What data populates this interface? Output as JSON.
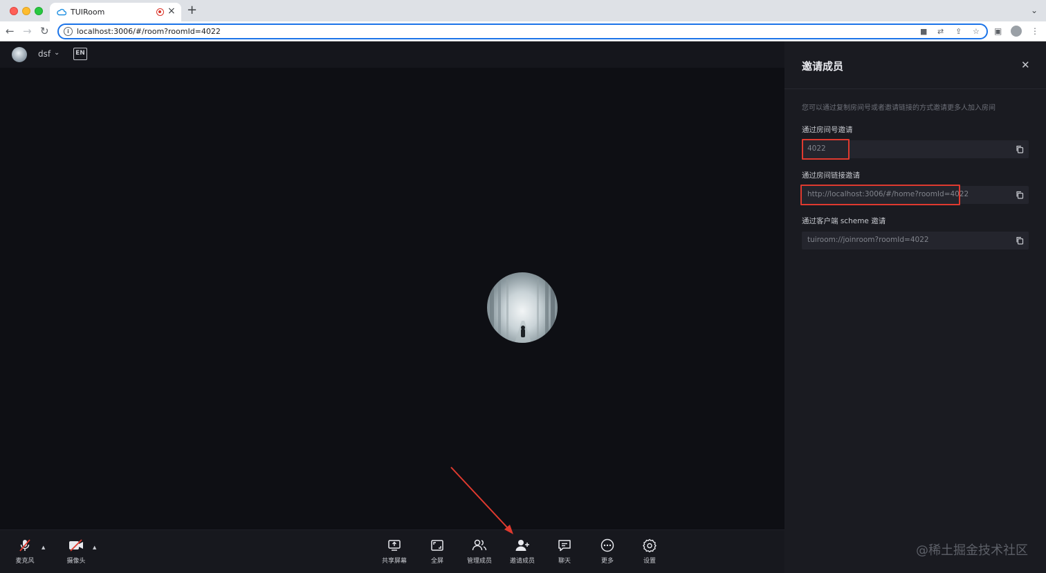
{
  "browser": {
    "tab_title": "TUIRoom",
    "url": "localhost:3006/#/room?roomId=4022",
    "accent": "#1a73e8"
  },
  "header": {
    "user_name": "dsf",
    "lang_label": "EN"
  },
  "toolbar": {
    "mic_label": "麦克风",
    "camera_label": "摄像头",
    "share_label": "共享屏幕",
    "fullscreen_label": "全屏",
    "manage_label": "管理成员",
    "invite_label": "邀请成员",
    "chat_label": "聊天",
    "more_label": "更多",
    "settings_label": "设置"
  },
  "panel": {
    "title": "邀请成员",
    "description": "您可以通过复制房间号或者邀请链接的方式邀请更多人加入房间",
    "room_id_label": "通过房间号邀请",
    "room_id_value": "4022",
    "link_label": "通过房间链接邀请",
    "link_value": "http://localhost:3006/#/home?roomId=4022",
    "scheme_label": "通过客户端 scheme 邀请",
    "scheme_value": "tuiroom://joinroom?roomId=4022",
    "highlight_color": "#e03a2f"
  },
  "watermark": "@稀土掘金技术社区"
}
